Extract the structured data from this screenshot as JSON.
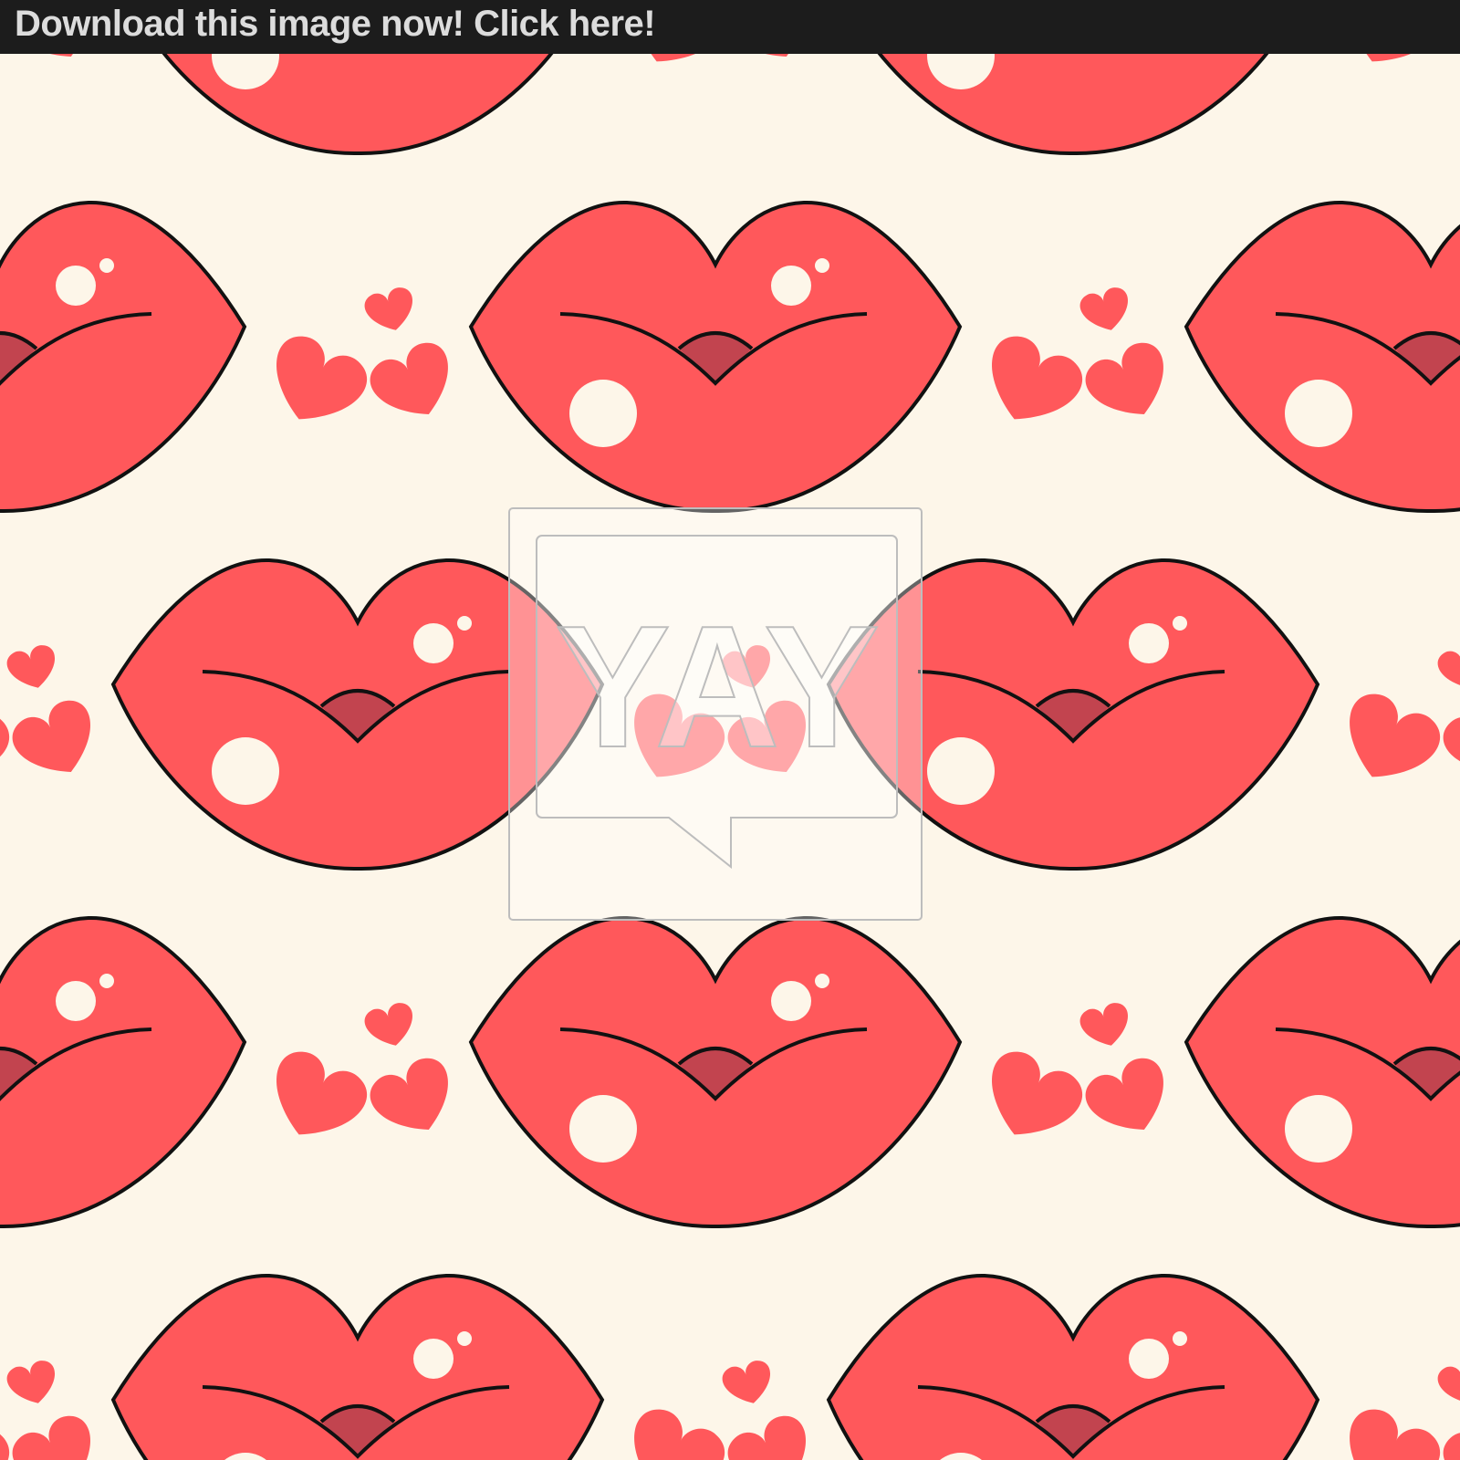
{
  "banner": {
    "text": "Download this image now! Click here!"
  },
  "watermark": {
    "text": "YAY"
  },
  "colors": {
    "background": "#fdf6e9",
    "lip": "#ff585b",
    "outline": "#111111",
    "tongue": "#c2444f",
    "highlight": "#fdf6e9",
    "heart": "#ff585b",
    "banner_bg": "#1c1c1c",
    "banner_text": "#dcdcdc"
  },
  "icons": {
    "lip": "lips-icon",
    "heart": "heart-icon"
  }
}
